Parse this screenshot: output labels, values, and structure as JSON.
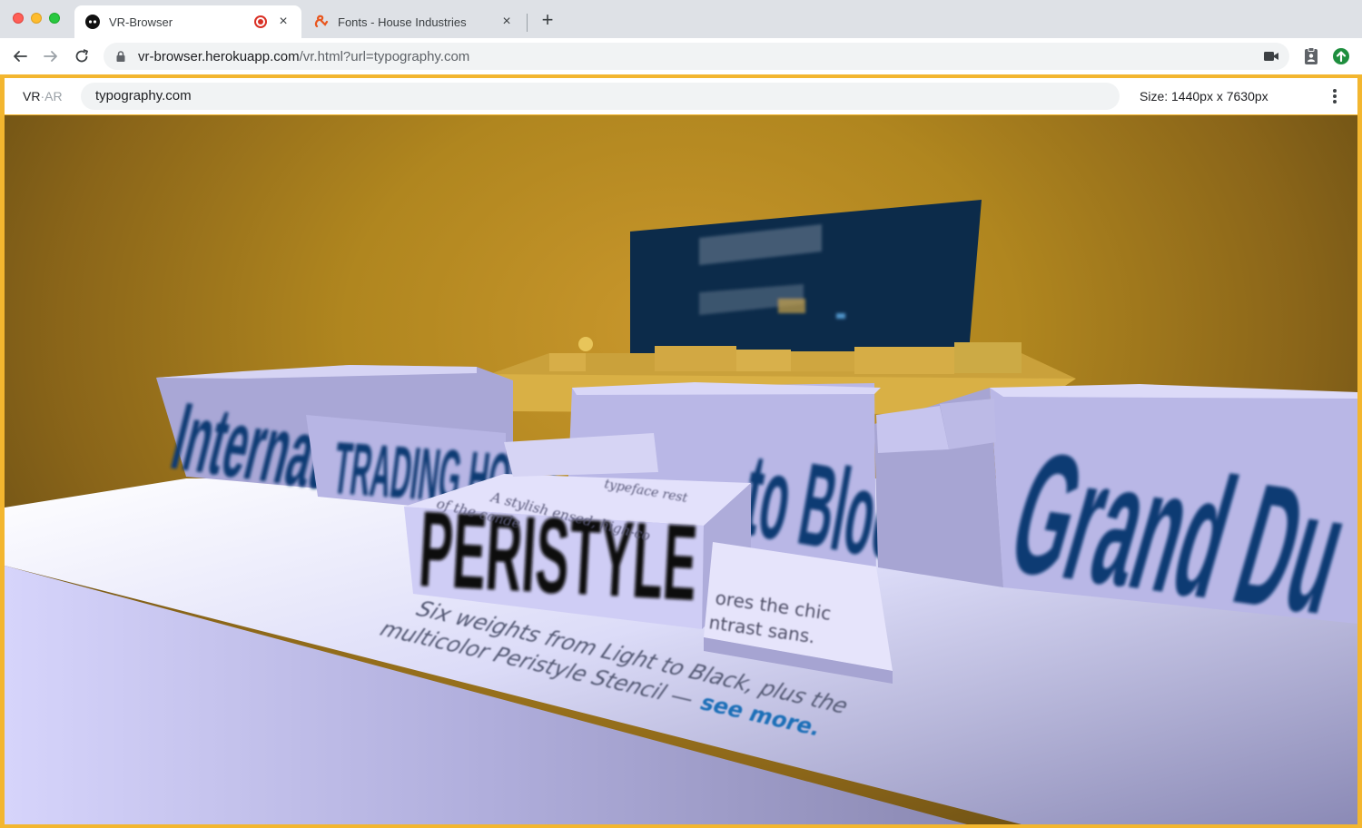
{
  "window": {
    "tabs": [
      {
        "title": "VR-Browser",
        "active": true,
        "recording": true
      },
      {
        "title": "Fonts - House Industries",
        "active": false
      }
    ],
    "new_tab_label": "+",
    "close_glyph": "×"
  },
  "toolbar": {
    "url_host": "vr-browser.herokuapp.com",
    "url_path": "/vr.html?url=typography.com"
  },
  "app": {
    "brand_vr": "VR",
    "brand_sep": "·",
    "brand_ar": "AR",
    "url_value": "typography.com",
    "size_text": "Size: 1440px x 7630px"
  },
  "scene": {
    "colors": {
      "sky": "#b0861f",
      "panel_navy": "#0c2b4a",
      "block_lavender": "#c9c7ee",
      "type_navy": "#0c3a73",
      "link_blue": "#1c6fb8"
    },
    "blocks": [
      {
        "text": "International"
      },
      {
        "text": "TRADING HOUSE"
      },
      {
        "text": "PERISTYLE"
      },
      {
        "text": "to Block"
      },
      {
        "text": "Grand Du"
      }
    ],
    "caption_line1": "Six weights from Light to Black, plus the",
    "caption_line2": "multicolor Peristyle Stencil —",
    "caption_link": "see more.",
    "small_line1": "A stylish ensed, high-co",
    "small_line2": "of the conde",
    "small_line3": "typeface rest",
    "side_line1": "ores the chic",
    "side_line2": "ntrast sans."
  }
}
